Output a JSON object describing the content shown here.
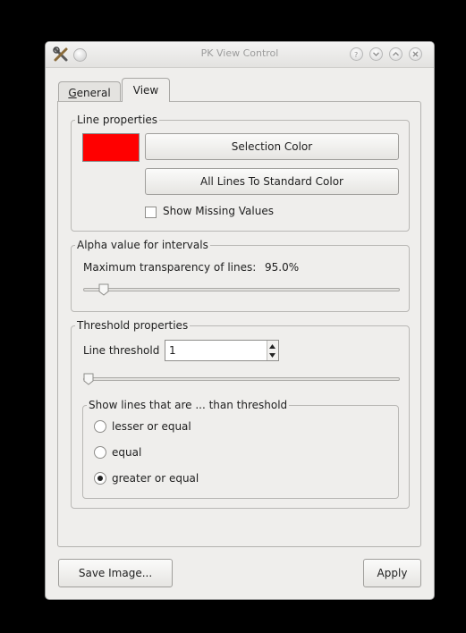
{
  "window": {
    "title": "PK View Control"
  },
  "tabs": [
    {
      "label": "General",
      "mnemonic": "G",
      "rest": "eneral"
    },
    {
      "label": "View"
    }
  ],
  "line_properties": {
    "title": "Line properties",
    "swatch_color": "#ff0000",
    "selection_color_label": "Selection Color",
    "standard_color_label": "All Lines To Standard Color",
    "show_missing_label": "Show Missing Values",
    "show_missing_checked": false
  },
  "alpha": {
    "title": "Alpha value for intervals",
    "label": "Maximum transparency of lines:",
    "value_text": "95.0%",
    "slider_fraction": 0.05
  },
  "threshold": {
    "title": "Threshold properties",
    "label": "Line threshold",
    "value": "1",
    "slider_fraction": 0.0,
    "subgroup_title": "Show lines that are ... than threshold",
    "options": [
      {
        "label": "lesser or equal",
        "selected": false
      },
      {
        "label": "equal",
        "selected": false
      },
      {
        "label": "greater or equal",
        "selected": true
      }
    ]
  },
  "footer": {
    "save_label": "Save Image...",
    "apply_label": "Apply"
  },
  "colors": {
    "accent": "#ff0000",
    "background": "#efeeec",
    "screen": "#000000"
  },
  "icons": {
    "app": "tools-icon",
    "title_buttons": [
      "help-icon",
      "minimize-icon",
      "maximize-icon",
      "close-icon"
    ]
  }
}
